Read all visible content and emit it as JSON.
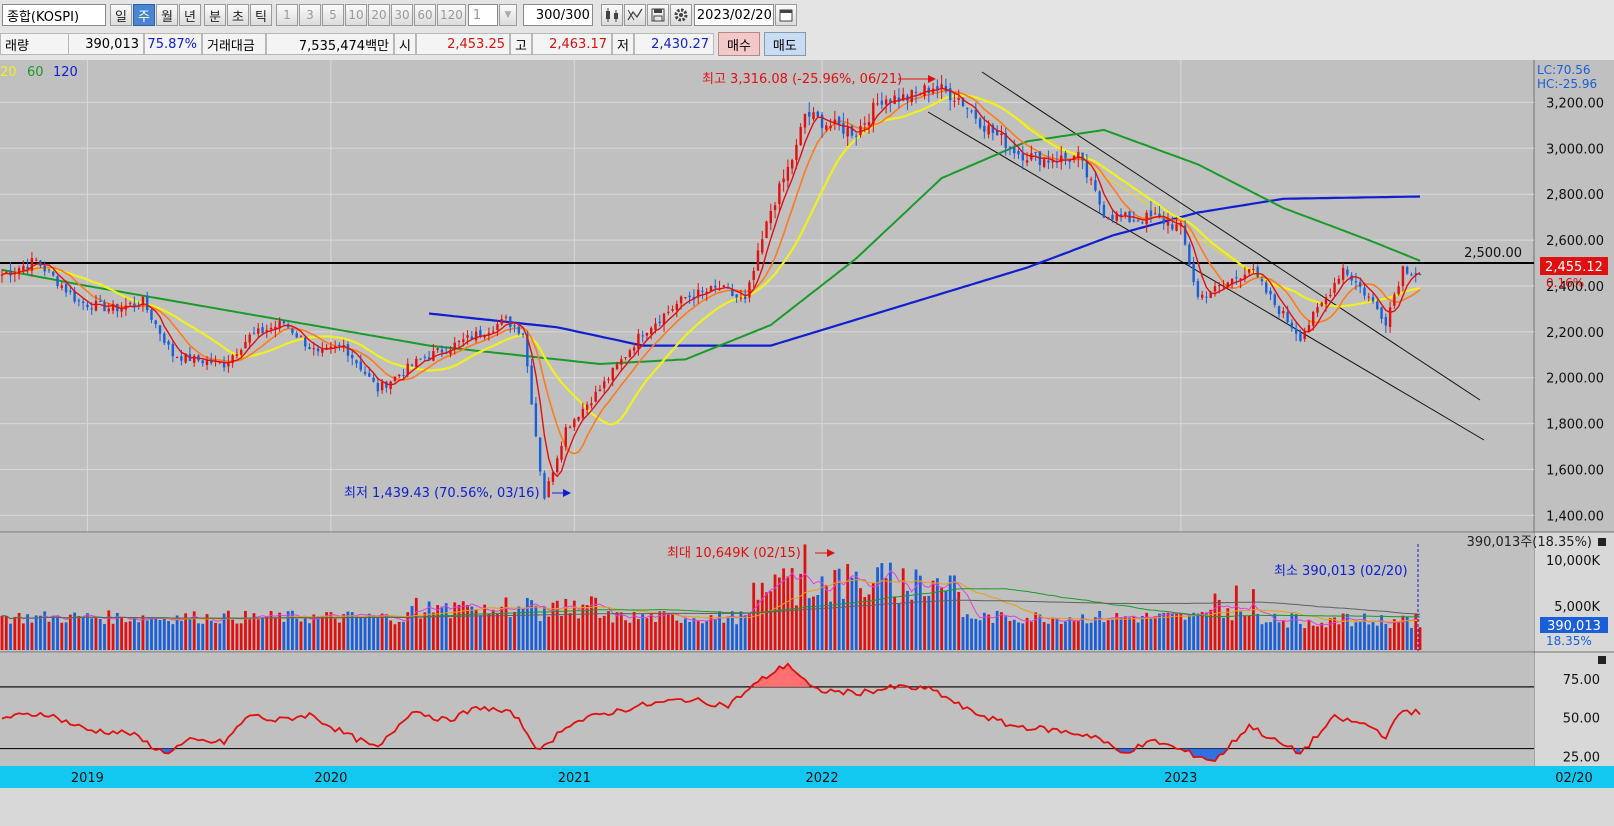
{
  "toolbar": {
    "market": "종합(KOSPI)",
    "periods": [
      "일",
      "주",
      "월",
      "년",
      "분",
      "초",
      "틱"
    ],
    "selected_period": "주",
    "intervals": [
      "1",
      "3",
      "5",
      "10",
      "20",
      "30",
      "60",
      "120"
    ],
    "repeat": "1",
    "count_value": "300",
    "count_total": "/300",
    "date": "2023/02/20",
    "icons": [
      "chart-type-icon",
      "draw-tools-icon",
      "save-icon",
      "settings-icon",
      "calendar-icon"
    ]
  },
  "quote": {
    "volume_label": "래량",
    "volume_value": "390,013",
    "volume_pct": "75.87%",
    "amount_label": "거래대금",
    "amount_value": "7,535,474백만",
    "open_label": "시",
    "open_value": "2,453.25",
    "high_label": "고",
    "high_value": "2,463.17",
    "low_label": "저",
    "low_value": "2,430.27",
    "buy_label": "매수",
    "sell_label": "매도"
  },
  "colors": {
    "up": "#e01010",
    "down": "#1a5fd8",
    "ma5": "#e01010",
    "ma10": "#ff7a1a",
    "ma20": "#f0f020",
    "ma60": "#1a9a2a",
    "ma120": "#1020d0",
    "background": "#c0c0c0",
    "axis_bar": "#13c8f0"
  },
  "chart_data": [
    {
      "type": "candlestick",
      "title": "",
      "ma_legend": [
        {
          "name": "20",
          "color": "#f0f020"
        },
        {
          "name": "60",
          "color": "#1a9a2a"
        },
        {
          "name": "120",
          "color": "#1020d0"
        }
      ],
      "corner_labels": [
        "LC:70.56",
        "HC:-25.96"
      ],
      "x_ticks": [
        "2019",
        "2020",
        "2021",
        "2022",
        "2023"
      ],
      "x_end_label": "02/20",
      "y_ticks": [
        "3,200.00",
        "3,000.00",
        "2,800.00",
        "2,600.00",
        "2,400.00",
        "2,200.00",
        "2,000.00",
        "1,800.00",
        "1,600.00",
        "1,400.00"
      ],
      "ylim": [
        1380,
        3350
      ],
      "horizontal_line": {
        "value": 2500,
        "label": "2,500.00"
      },
      "current_price": "2,455.12",
      "current_change": "0.16%",
      "annotation_high": "최고 3,316.08 (-25.96%, 06/21)",
      "annotation_low": "최저 1,439.43 (70.56%, 03/16)",
      "close_series": [
        {
          "t": 0,
          "v": 2450
        },
        {
          "t": 8,
          "v": 2510
        },
        {
          "t": 18,
          "v": 2330
        },
        {
          "t": 26,
          "v": 2300
        },
        {
          "t": 33,
          "v": 2330
        },
        {
          "t": 40,
          "v": 2100
        },
        {
          "t": 45,
          "v": 2080
        },
        {
          "t": 52,
          "v": 2060
        },
        {
          "t": 58,
          "v": 2180
        },
        {
          "t": 66,
          "v": 2240
        },
        {
          "t": 74,
          "v": 2100
        },
        {
          "t": 80,
          "v": 2140
        },
        {
          "t": 88,
          "v": 1950
        },
        {
          "t": 98,
          "v": 2080
        },
        {
          "t": 108,
          "v": 2160
        },
        {
          "t": 118,
          "v": 2250
        },
        {
          "t": 122,
          "v": 2200
        },
        {
          "t": 126,
          "v": 1600
        },
        {
          "t": 127,
          "v": 1480
        },
        {
          "t": 132,
          "v": 1780
        },
        {
          "t": 140,
          "v": 1950
        },
        {
          "t": 150,
          "v": 2200
        },
        {
          "t": 160,
          "v": 2350
        },
        {
          "t": 168,
          "v": 2390
        },
        {
          "t": 174,
          "v": 2330
        },
        {
          "t": 180,
          "v": 2730
        },
        {
          "t": 186,
          "v": 3000
        },
        {
          "t": 188,
          "v": 3150
        },
        {
          "t": 194,
          "v": 3100
        },
        {
          "t": 200,
          "v": 3070
        },
        {
          "t": 206,
          "v": 3220
        },
        {
          "t": 212,
          "v": 3220
        },
        {
          "t": 218,
          "v": 3270
        },
        {
          "t": 224,
          "v": 3220
        },
        {
          "t": 230,
          "v": 3100
        },
        {
          "t": 238,
          "v": 2980
        },
        {
          "t": 244,
          "v": 2950
        },
        {
          "t": 252,
          "v": 2960
        },
        {
          "t": 258,
          "v": 2720
        },
        {
          "t": 264,
          "v": 2690
        },
        {
          "t": 270,
          "v": 2700
        },
        {
          "t": 276,
          "v": 2650
        },
        {
          "t": 280,
          "v": 2350
        },
        {
          "t": 286,
          "v": 2400
        },
        {
          "t": 292,
          "v": 2480
        },
        {
          "t": 298,
          "v": 2320
        },
        {
          "t": 304,
          "v": 2180
        },
        {
          "t": 310,
          "v": 2350
        },
        {
          "t": 314,
          "v": 2480
        },
        {
          "t": 320,
          "v": 2350
        },
        {
          "t": 324,
          "v": 2250
        },
        {
          "t": 328,
          "v": 2480
        },
        {
          "t": 332,
          "v": 2455
        }
      ],
      "ma60_series": [
        {
          "t": 0,
          "v": 2470
        },
        {
          "t": 20,
          "v": 2400
        },
        {
          "t": 60,
          "v": 2270
        },
        {
          "t": 100,
          "v": 2140
        },
        {
          "t": 140,
          "v": 2060
        },
        {
          "t": 160,
          "v": 2080
        },
        {
          "t": 180,
          "v": 2230
        },
        {
          "t": 200,
          "v": 2520
        },
        {
          "t": 220,
          "v": 2870
        },
        {
          "t": 240,
          "v": 3030
        },
        {
          "t": 258,
          "v": 3080
        },
        {
          "t": 280,
          "v": 2930
        },
        {
          "t": 300,
          "v": 2740
        },
        {
          "t": 320,
          "v": 2600
        },
        {
          "t": 332,
          "v": 2510
        }
      ],
      "ma120_series": [
        {
          "t": 100,
          "v": 2280
        },
        {
          "t": 130,
          "v": 2220
        },
        {
          "t": 150,
          "v": 2140
        },
        {
          "t": 180,
          "v": 2140
        },
        {
          "t": 210,
          "v": 2310
        },
        {
          "t": 240,
          "v": 2480
        },
        {
          "t": 260,
          "v": 2620
        },
        {
          "t": 280,
          "v": 2720
        },
        {
          "t": 300,
          "v": 2780
        },
        {
          "t": 332,
          "v": 2790
        }
      ]
    },
    {
      "type": "bar",
      "title": "",
      "y_ticks": [
        "10,000K",
        "5,000K"
      ],
      "current_label": "390,013주(18.35%)",
      "current_value": "390,013",
      "current_pct": "18.35%",
      "annotation_max": "최대 10,649K (02/15)",
      "annotation_min": "최소 390,013 (02/20)",
      "max_value_k": 10649
    },
    {
      "type": "line",
      "title": "",
      "y_ticks": [
        "75.00",
        "50.00",
        "25.00"
      ],
      "ylim": [
        20,
        90
      ],
      "levels": [
        70,
        30
      ],
      "series": [
        {
          "t": 0,
          "v": 50
        },
        {
          "t": 10,
          "v": 53
        },
        {
          "t": 20,
          "v": 42
        },
        {
          "t": 30,
          "v": 40
        },
        {
          "t": 38,
          "v": 27
        },
        {
          "t": 44,
          "v": 35
        },
        {
          "t": 52,
          "v": 34
        },
        {
          "t": 58,
          "v": 52
        },
        {
          "t": 64,
          "v": 48
        },
        {
          "t": 72,
          "v": 52
        },
        {
          "t": 80,
          "v": 40
        },
        {
          "t": 88,
          "v": 30
        },
        {
          "t": 96,
          "v": 55
        },
        {
          "t": 104,
          "v": 48
        },
        {
          "t": 112,
          "v": 57
        },
        {
          "t": 120,
          "v": 52
        },
        {
          "t": 126,
          "v": 28
        },
        {
          "t": 132,
          "v": 45
        },
        {
          "t": 140,
          "v": 52
        },
        {
          "t": 150,
          "v": 58
        },
        {
          "t": 160,
          "v": 62
        },
        {
          "t": 170,
          "v": 58
        },
        {
          "t": 178,
          "v": 75
        },
        {
          "t": 184,
          "v": 85
        },
        {
          "t": 190,
          "v": 68
        },
        {
          "t": 200,
          "v": 66
        },
        {
          "t": 210,
          "v": 70
        },
        {
          "t": 218,
          "v": 68
        },
        {
          "t": 226,
          "v": 55
        },
        {
          "t": 236,
          "v": 45
        },
        {
          "t": 246,
          "v": 42
        },
        {
          "t": 256,
          "v": 38
        },
        {
          "t": 262,
          "v": 27
        },
        {
          "t": 270,
          "v": 35
        },
        {
          "t": 278,
          "v": 27
        },
        {
          "t": 284,
          "v": 22
        },
        {
          "t": 292,
          "v": 45
        },
        {
          "t": 298,
          "v": 35
        },
        {
          "t": 304,
          "v": 27
        },
        {
          "t": 312,
          "v": 50
        },
        {
          "t": 320,
          "v": 45
        },
        {
          "t": 324,
          "v": 38
        },
        {
          "t": 328,
          "v": 55
        },
        {
          "t": 332,
          "v": 53
        }
      ]
    }
  ]
}
